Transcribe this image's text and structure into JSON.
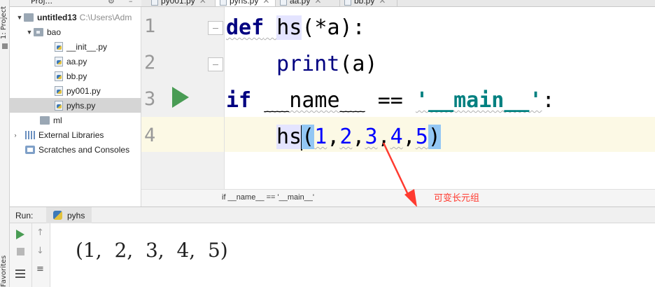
{
  "project_panel": {
    "title": "Proj...",
    "tree": [
      {
        "label": "untitled13",
        "hint": "C:\\Users\\Adm",
        "type": "folder"
      },
      {
        "label": "bao",
        "type": "package"
      },
      {
        "label": "__init__.py",
        "type": "file"
      },
      {
        "label": "aa.py",
        "type": "file"
      },
      {
        "label": "bb.py",
        "type": "file"
      },
      {
        "label": "py001.py",
        "type": "file"
      },
      {
        "label": "pyhs.py",
        "type": "file",
        "selected": true
      },
      {
        "label": "ml",
        "type": "folder"
      },
      {
        "label": "External Libraries",
        "type": "library"
      },
      {
        "label": "Scratches and Consoles",
        "type": "scratch"
      }
    ]
  },
  "side_tabs": {
    "project": "1: Project",
    "favorites": "Favorites"
  },
  "tabs": [
    {
      "label": "py001.py"
    },
    {
      "label": "pyhs.py",
      "active": true
    },
    {
      "label": "aa.py"
    },
    {
      "label": "bb.py"
    }
  ],
  "editor": {
    "line_numbers": [
      "1",
      "2",
      "3",
      "4"
    ],
    "lines": {
      "l1_kw": "def",
      "l1_name": "hs",
      "l1_params": "(*a):",
      "l2_fn": "print",
      "l2_rest": "(a)",
      "l3_kw": "if",
      "l3_name": "__name__",
      "l3_op": " == ",
      "l3_str": "'__main__'",
      "l3_colon": ":",
      "l4_fn": "hs",
      "l4_open": "(",
      "l4_args": [
        "1",
        "2",
        "3",
        "4",
        "5"
      ],
      "l4_close": ")"
    },
    "breadcrumb": "if __name__ == '__main__'"
  },
  "annotation": {
    "text": "可变长元组",
    "color": "#ff3b30"
  },
  "run_panel": {
    "label": "Run:",
    "tab": "pyhs",
    "output": "(1,  2,  3,  4,  5)"
  },
  "colors": {
    "run_green": "#499c54",
    "keyword": "#000080",
    "string": "#008080",
    "number": "#0000ff"
  }
}
